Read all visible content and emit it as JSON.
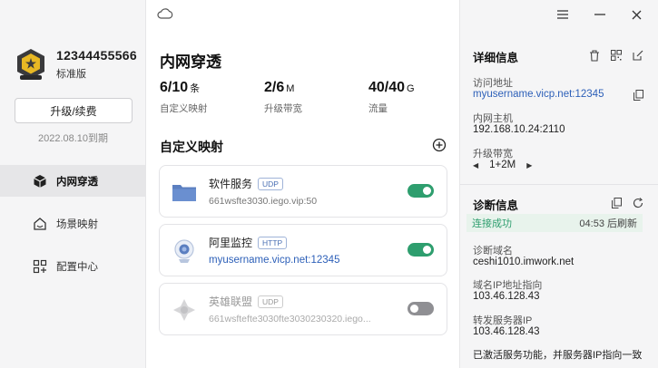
{
  "account": {
    "id": "12344455566",
    "plan": "标准版",
    "upgrade_label": "升级/续费",
    "expiry": "2022.08.10到期"
  },
  "nav": [
    {
      "label": "内网穿透",
      "icon": "cube-icon",
      "active": true
    },
    {
      "label": "场景映射",
      "icon": "home-icon",
      "active": false
    },
    {
      "label": "配置中心",
      "icon": "grid-icon",
      "active": false
    }
  ],
  "main": {
    "title": "内网穿透",
    "stats": [
      {
        "value": "6/10",
        "unit": "条",
        "label": "自定义映射"
      },
      {
        "value": "2/6",
        "unit": "M",
        "label": "升级带宽"
      },
      {
        "value": "40/40",
        "unit": "G",
        "label": "流量"
      }
    ],
    "section_title": "自定义映射",
    "mappings": [
      {
        "name": "软件服务",
        "protocol": "UDP",
        "address": "661wsfte3030.iego.vip:50",
        "enabled": true,
        "icon": "folder-icon"
      },
      {
        "name": "阿里监控",
        "protocol": "HTTP",
        "address": "myusername.vicp.net:12345",
        "enabled": true,
        "icon": "camera-icon"
      },
      {
        "name": "英雄联盟",
        "protocol": "UDP",
        "address": "661wsftefte3030fte3030230320.iego...",
        "enabled": false,
        "icon": "game-icon"
      }
    ]
  },
  "details": {
    "title": "详细信息",
    "access_label": "访问地址",
    "access_value": "myusername.vicp.net:12345",
    "host_label": "内网主机",
    "host_value": "192.168.10.24:2110",
    "bw_label": "升级带宽",
    "bw_value": "1+2M"
  },
  "diagnostics": {
    "title": "诊断信息",
    "status": "连接成功",
    "refresh": "04:53 后刷新",
    "domain_label": "诊断域名",
    "domain_value": "ceshi1010.imwork.net",
    "ip_label": "域名IP地址指向",
    "ip_value": "103.46.128.43",
    "fwd_label": "转发服务器IP",
    "fwd_value": "103.46.128.43",
    "note": "已激活服务功能，并服务器IP指向一致"
  },
  "colors": {
    "accent_green": "#2e9e6e",
    "link_blue": "#2c5fb8",
    "badge_blue": "#4a6fb3"
  }
}
